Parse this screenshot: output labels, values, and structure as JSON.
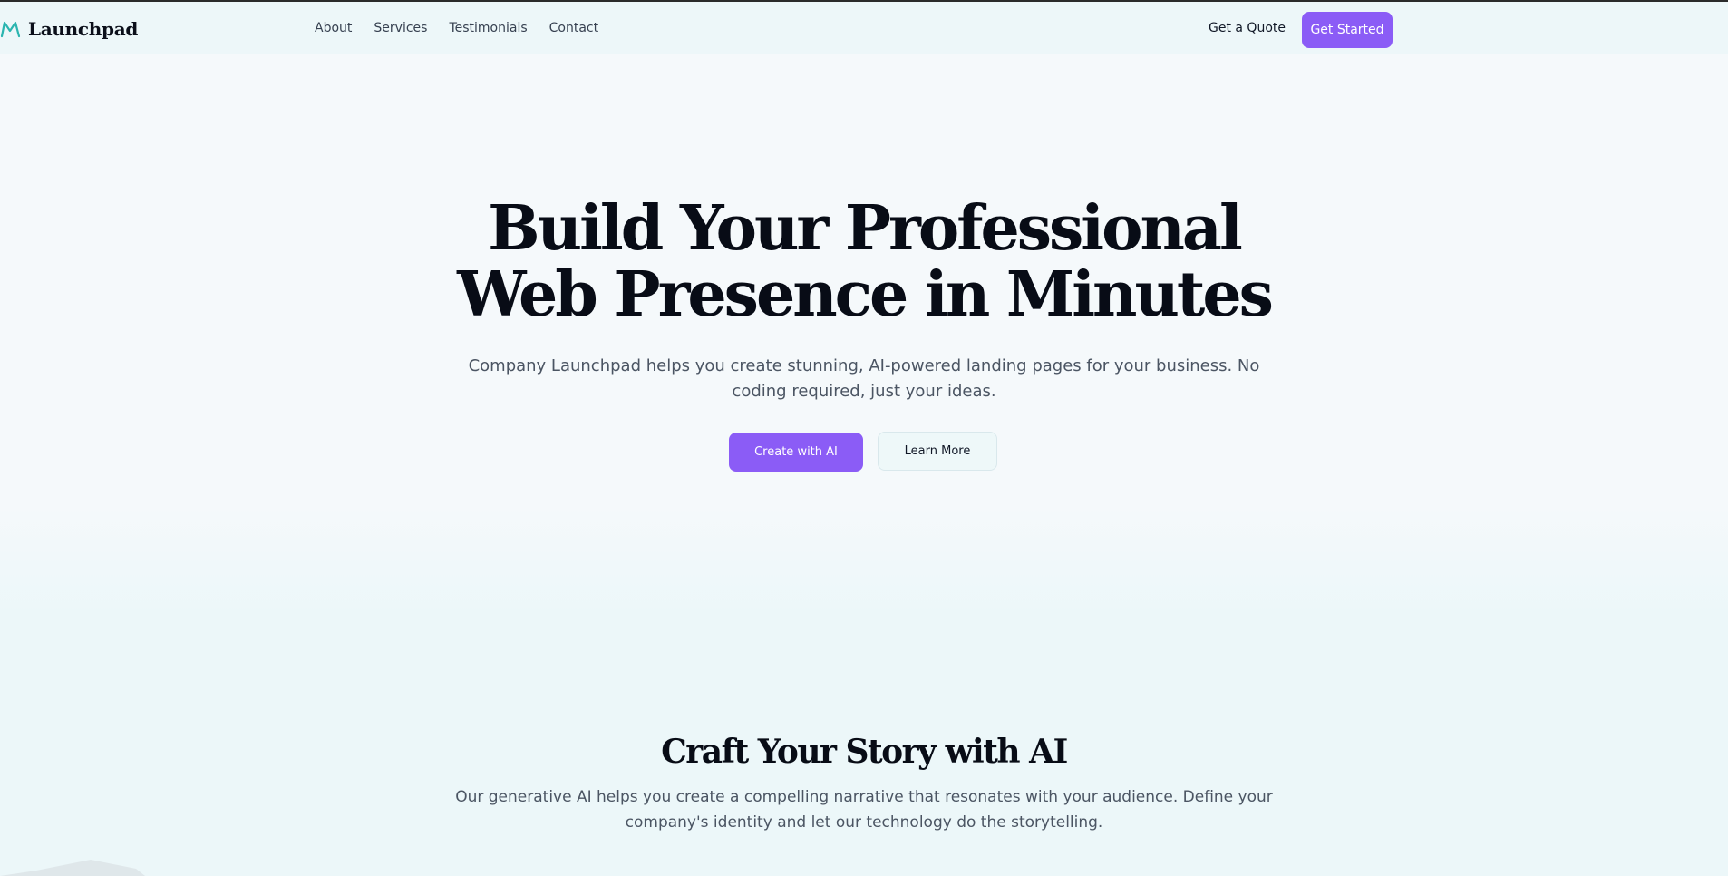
{
  "nav": {
    "logo": "Launchpad",
    "links": [
      "About",
      "Services",
      "Testimonials",
      "Contact"
    ],
    "quote_label": "Get a Quote",
    "cta_label": "Get Started"
  },
  "hero": {
    "title_line1": "Build Your Professional",
    "title_line2": "Web Presence in Minutes",
    "subtitle": "Company Launchpad helps you create stunning, AI-powered landing pages for your business. No coding required, just your ideas.",
    "primary_button": "Create with AI",
    "secondary_button": "Learn More"
  },
  "story": {
    "title": "Craft Your Story with AI",
    "subtitle": "Our generative AI helps you create a compelling narrative that resonates with your audience. Define your company's identity and let our technology do the storytelling."
  },
  "colors": {
    "accent": "#8b5cf6",
    "logo_icon": "#2bb5b0",
    "nav_bg": "#edf7f9",
    "heading": "#080c16",
    "body_text": "#4b5563"
  },
  "icons": {
    "logo": "mountain-icon"
  }
}
